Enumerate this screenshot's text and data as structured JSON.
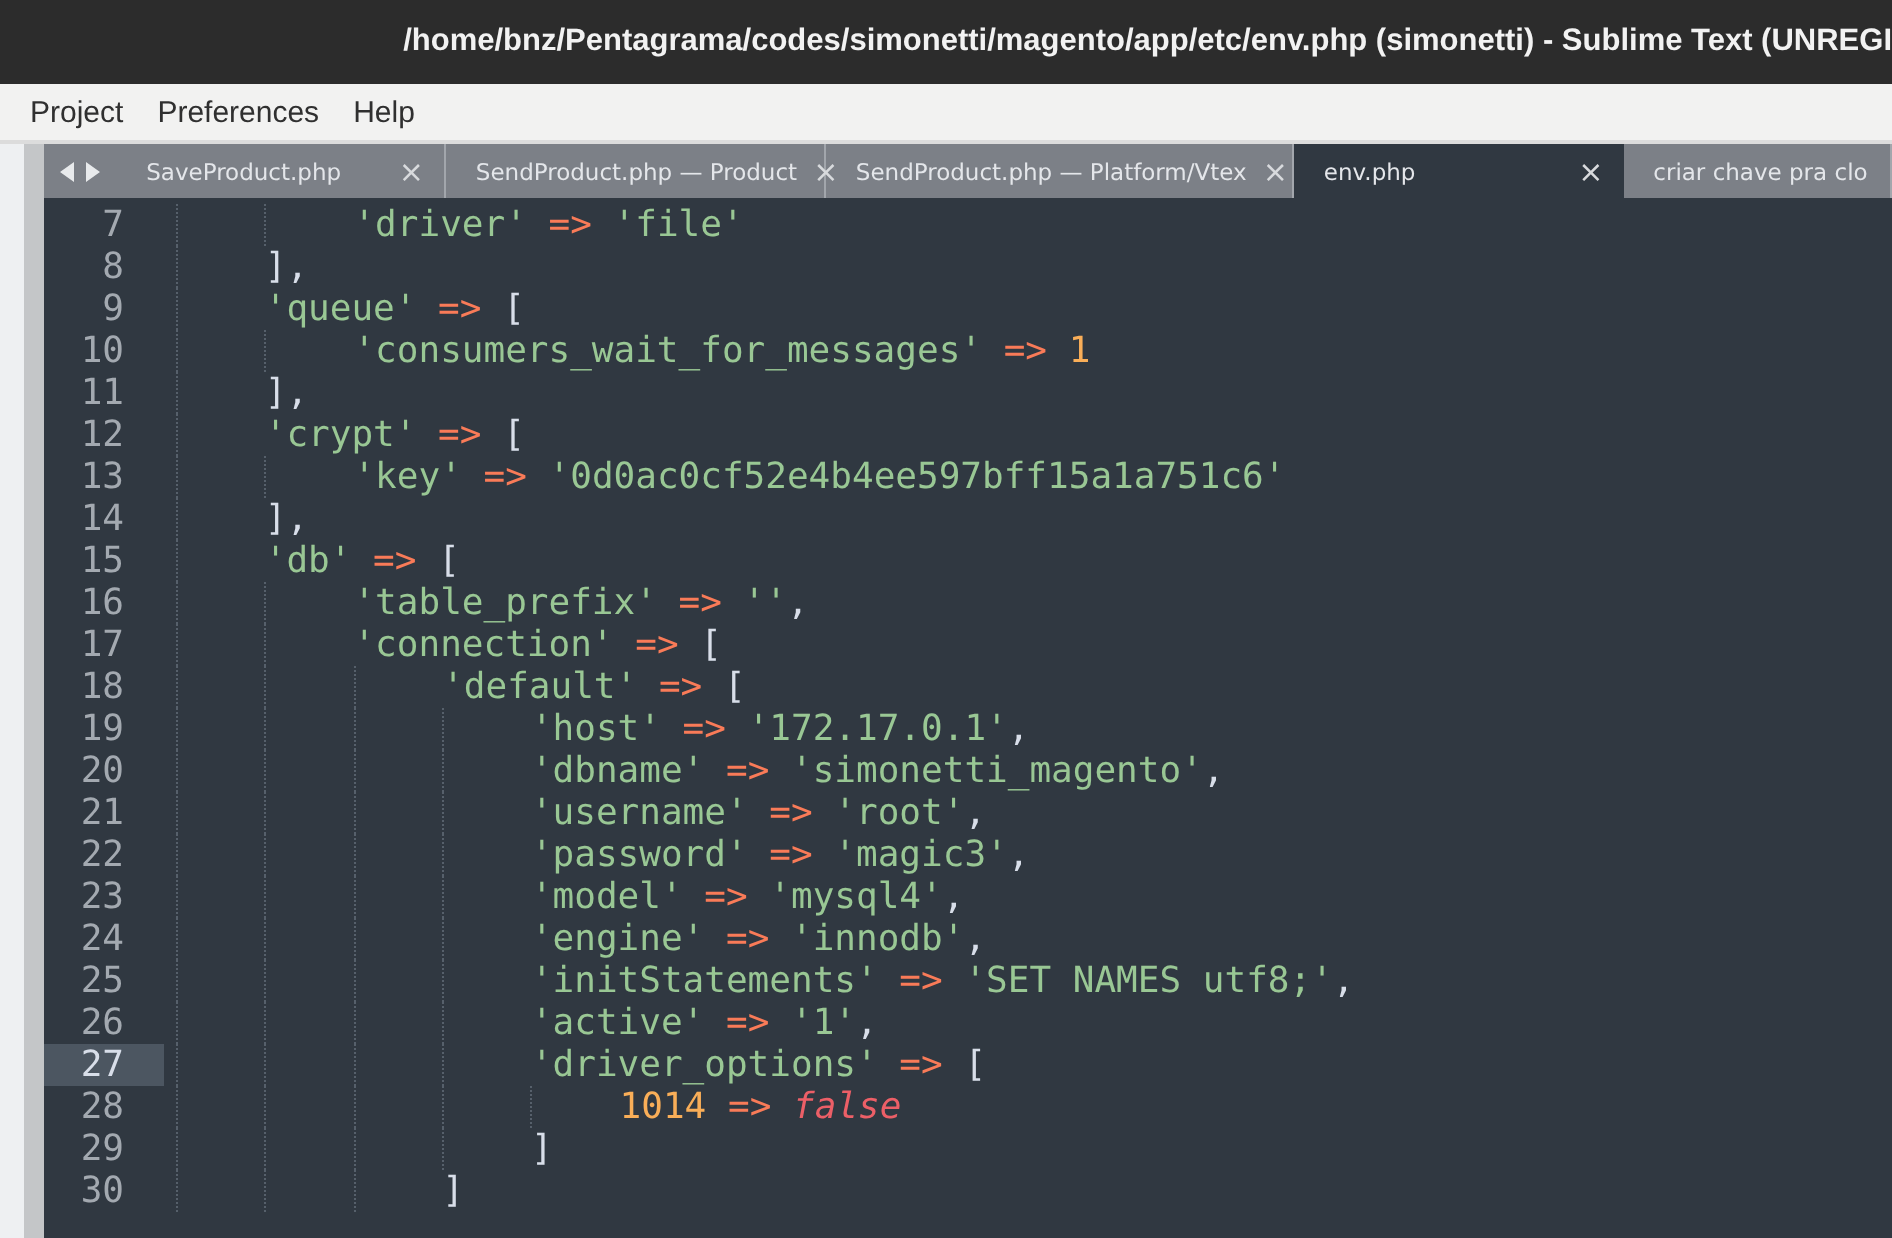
{
  "window": {
    "title": "/home/bnz/Pentagrama/codes/simonetti/magento/app/etc/env.php (simonetti) - Sublime Text (UNREGI"
  },
  "menu": [
    "Project",
    "Preferences",
    "Help"
  ],
  "tabs": [
    {
      "label": "SaveProduct.php",
      "close": "×",
      "selected": false
    },
    {
      "label": "SendProduct.php — Product",
      "close": "×",
      "selected": false
    },
    {
      "label": "SendProduct.php — Platform/Vtex",
      "close": "×",
      "selected": false
    },
    {
      "label": "env.php",
      "close": "×",
      "selected": true
    },
    {
      "label": "criar chave pra clo",
      "selected": false
    }
  ],
  "lines": [
    {
      "number": "7",
      "selected": false,
      "tokens": [
        {
          "kind": "string",
          "text": "        'driver'"
        },
        {
          "kind": "operator",
          "text": " => "
        },
        {
          "kind": "string",
          "text": "'file'"
        }
      ]
    },
    {
      "number": "8",
      "selected": false,
      "tokens": [
        {
          "kind": "punct",
          "text": "    ],"
        }
      ]
    },
    {
      "number": "9",
      "selected": false,
      "tokens": [
        {
          "kind": "string",
          "text": "    'queue'"
        },
        {
          "kind": "operator",
          "text": " => "
        },
        {
          "kind": "punct",
          "text": "["
        }
      ]
    },
    {
      "number": "10",
      "selected": false,
      "tokens": [
        {
          "kind": "string",
          "text": "        'consumers_wait_for_messages'"
        },
        {
          "kind": "operator",
          "text": " => "
        },
        {
          "kind": "number",
          "text": "1"
        }
      ]
    },
    {
      "number": "11",
      "selected": false,
      "tokens": [
        {
          "kind": "punct",
          "text": "    ],"
        }
      ]
    },
    {
      "number": "12",
      "selected": false,
      "tokens": [
        {
          "kind": "string",
          "text": "    'crypt'"
        },
        {
          "kind": "operator",
          "text": " => "
        },
        {
          "kind": "punct",
          "text": "["
        }
      ]
    },
    {
      "number": "13",
      "selected": false,
      "tokens": [
        {
          "kind": "string",
          "text": "        'key'"
        },
        {
          "kind": "operator",
          "text": " => "
        },
        {
          "kind": "string",
          "text": "'0d0ac0cf52e4b4ee597bff15a1a751c6'"
        }
      ]
    },
    {
      "number": "14",
      "selected": false,
      "tokens": [
        {
          "kind": "punct",
          "text": "    ],"
        }
      ]
    },
    {
      "number": "15",
      "selected": false,
      "tokens": [
        {
          "kind": "string",
          "text": "    'db'"
        },
        {
          "kind": "operator",
          "text": " => "
        },
        {
          "kind": "punct",
          "text": "["
        }
      ]
    },
    {
      "number": "16",
      "selected": false,
      "tokens": [
        {
          "kind": "string",
          "text": "        'table_prefix'"
        },
        {
          "kind": "operator",
          "text": " => "
        },
        {
          "kind": "string",
          "text": "''"
        },
        {
          "kind": "punct",
          "text": ","
        }
      ]
    },
    {
      "number": "17",
      "selected": false,
      "tokens": [
        {
          "kind": "string",
          "text": "        'connection'"
        },
        {
          "kind": "operator",
          "text": " => "
        },
        {
          "kind": "punct",
          "text": "["
        }
      ]
    },
    {
      "number": "18",
      "selected": false,
      "tokens": [
        {
          "kind": "string",
          "text": "            'default'"
        },
        {
          "kind": "operator",
          "text": " => "
        },
        {
          "kind": "punct",
          "text": "["
        }
      ]
    },
    {
      "number": "19",
      "selected": false,
      "tokens": [
        {
          "kind": "string",
          "text": "                'host'"
        },
        {
          "kind": "operator",
          "text": " => "
        },
        {
          "kind": "string",
          "text": "'172.17.0.1'"
        },
        {
          "kind": "punct",
          "text": ","
        }
      ]
    },
    {
      "number": "20",
      "selected": false,
      "tokens": [
        {
          "kind": "string",
          "text": "                'dbname'"
        },
        {
          "kind": "operator",
          "text": " => "
        },
        {
          "kind": "string",
          "text": "'simonetti_magento'"
        },
        {
          "kind": "punct",
          "text": ","
        }
      ]
    },
    {
      "number": "21",
      "selected": false,
      "tokens": [
        {
          "kind": "string",
          "text": "                'username'"
        },
        {
          "kind": "operator",
          "text": " => "
        },
        {
          "kind": "string",
          "text": "'root'"
        },
        {
          "kind": "punct",
          "text": ","
        }
      ]
    },
    {
      "number": "22",
      "selected": false,
      "tokens": [
        {
          "kind": "string",
          "text": "                'password'"
        },
        {
          "kind": "operator",
          "text": " => "
        },
        {
          "kind": "string",
          "text": "'magic3'"
        },
        {
          "kind": "punct",
          "text": ","
        }
      ]
    },
    {
      "number": "23",
      "selected": false,
      "tokens": [
        {
          "kind": "string",
          "text": "                'model'"
        },
        {
          "kind": "operator",
          "text": " => "
        },
        {
          "kind": "string",
          "text": "'mysql4'"
        },
        {
          "kind": "punct",
          "text": ","
        }
      ]
    },
    {
      "number": "24",
      "selected": false,
      "tokens": [
        {
          "kind": "string",
          "text": "                'engine'"
        },
        {
          "kind": "operator",
          "text": " => "
        },
        {
          "kind": "string",
          "text": "'innodb'"
        },
        {
          "kind": "punct",
          "text": ","
        }
      ]
    },
    {
      "number": "25",
      "selected": false,
      "tokens": [
        {
          "kind": "string",
          "text": "                'initStatements'"
        },
        {
          "kind": "operator",
          "text": " => "
        },
        {
          "kind": "string",
          "text": "'SET NAMES utf8;'"
        },
        {
          "kind": "punct",
          "text": ","
        }
      ]
    },
    {
      "number": "26",
      "selected": false,
      "tokens": [
        {
          "kind": "string",
          "text": "                'active'"
        },
        {
          "kind": "operator",
          "text": " => "
        },
        {
          "kind": "string",
          "text": "'1'"
        },
        {
          "kind": "punct",
          "text": ","
        }
      ]
    },
    {
      "number": "27",
      "selected": true,
      "tokens": [
        {
          "kind": "string",
          "text": "                'driver_options'"
        },
        {
          "kind": "operator",
          "text": " => "
        },
        {
          "kind": "punct",
          "text": "["
        }
      ]
    },
    {
      "number": "28",
      "selected": false,
      "tokens": [
        {
          "kind": "number",
          "text": "                    1014"
        },
        {
          "kind": "operator",
          "text": " => "
        },
        {
          "kind": "constant",
          "text": "false"
        }
      ]
    },
    {
      "number": "29",
      "selected": false,
      "tokens": [
        {
          "kind": "punct",
          "text": "                ]"
        }
      ]
    },
    {
      "number": "30",
      "selected": false,
      "tokens": [
        {
          "kind": "punct",
          "text": "            ]"
        }
      ]
    }
  ]
}
